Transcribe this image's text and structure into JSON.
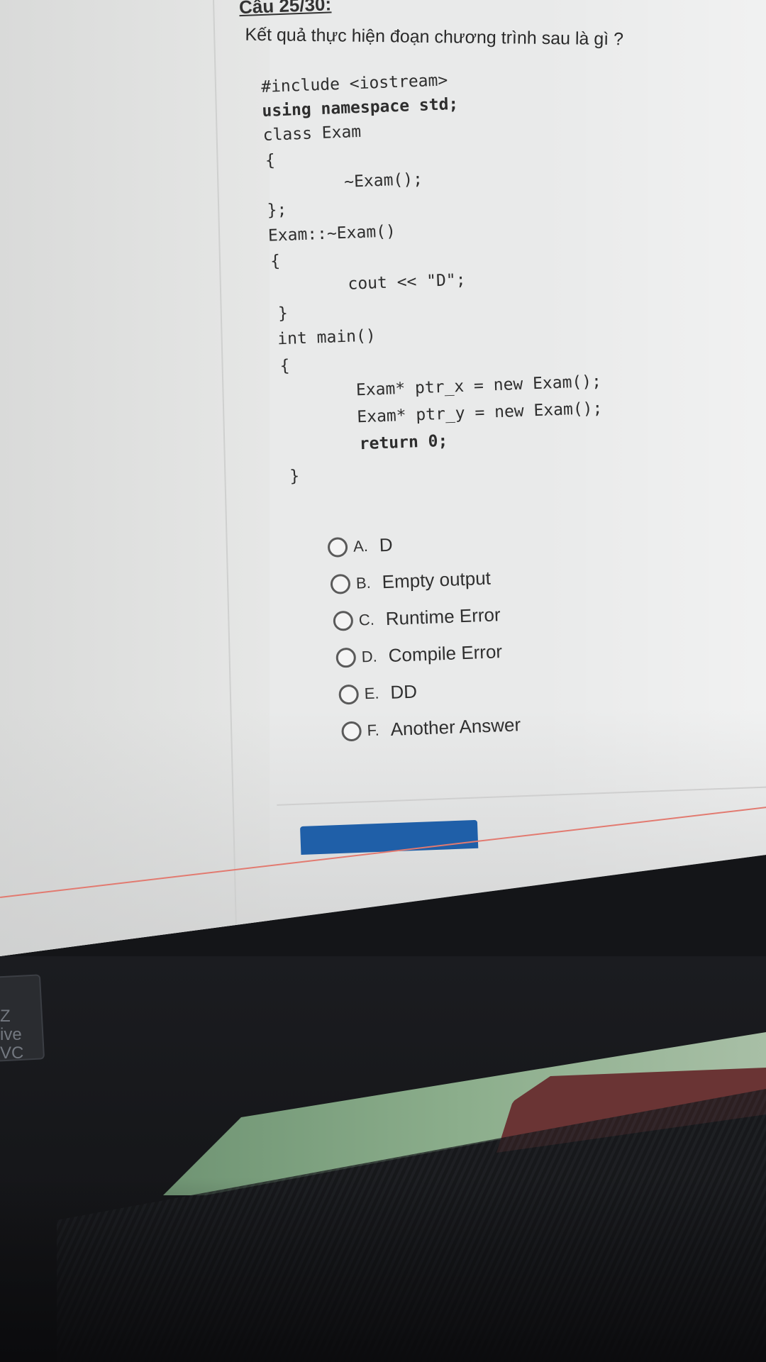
{
  "question": {
    "number": "Câu 25/30:",
    "text": "Kết quả thực hiện đoạn chương trình sau là gì ?"
  },
  "code": {
    "lines": [
      "#include <iostream>",
      "using namespace std;",
      "class Exam",
      "{",
      "~Exam();",
      "};",
      "Exam::~Exam()",
      "{",
      "cout << \"D\";",
      "}",
      "int main()",
      "{",
      "Exam* ptr_x = new Exam();",
      "Exam* ptr_y = new Exam();",
      "return 0;",
      "}"
    ]
  },
  "options": [
    {
      "letter": "A.",
      "text": "D"
    },
    {
      "letter": "B.",
      "text": "Empty output"
    },
    {
      "letter": "C.",
      "text": "Runtime Error"
    },
    {
      "letter": "D.",
      "text": "Compile Error"
    },
    {
      "letter": "E.",
      "text": "DD"
    },
    {
      "letter": "F.",
      "text": "Another Answer"
    }
  ],
  "bezel": {
    "sticker_text": "Z\nive\nVC"
  },
  "colors": {
    "screen": "#e9eaea",
    "submit_button": "#1f5fa8",
    "bezel": "#17181b",
    "red_rule": "#e27a70"
  }
}
